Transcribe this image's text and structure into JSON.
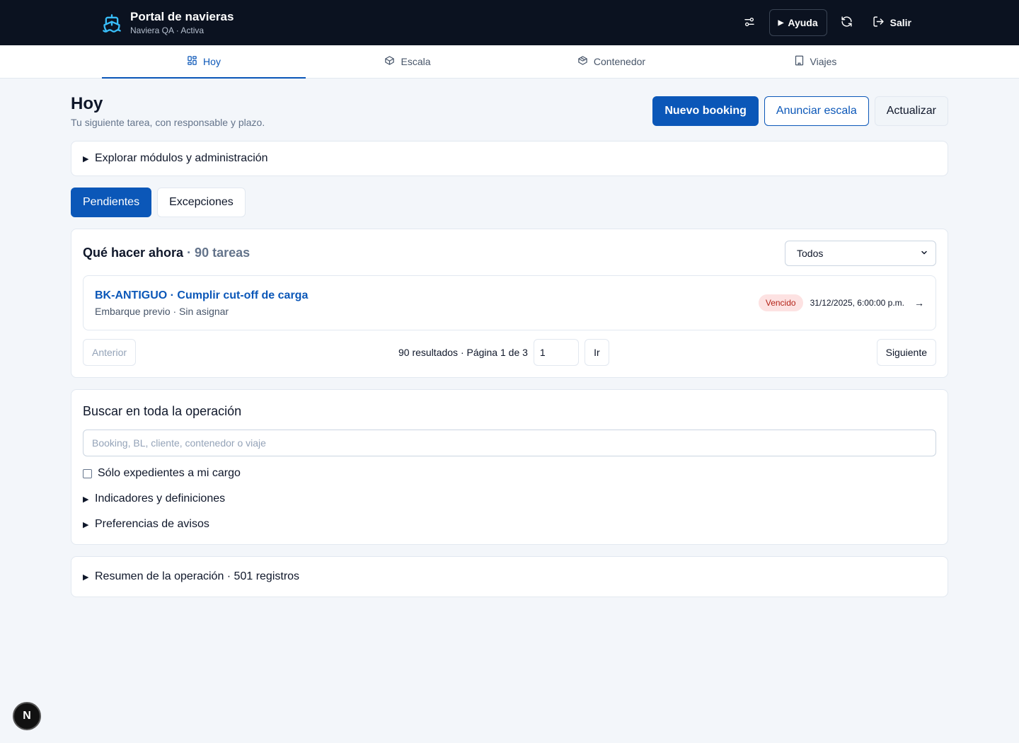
{
  "header": {
    "app_title": "Portal de navieras",
    "app_subtitle": "Naviera QA · Activa",
    "brand_icon": "ship-icon",
    "help_label": "Ayuda",
    "logout_label": "Salir",
    "icons": [
      "sliders-icon",
      "play-icon",
      "refresh-icon",
      "logout-icon"
    ]
  },
  "nav": {
    "tabs": [
      {
        "label": "Hoy",
        "icon": "grid-icon",
        "active": true
      },
      {
        "label": "Escala",
        "icon": "box-icon",
        "active": false
      },
      {
        "label": "Contenedor",
        "icon": "container-icon",
        "active": false
      },
      {
        "label": "Viajes",
        "icon": "building-icon",
        "active": false
      }
    ]
  },
  "page": {
    "title": "Hoy",
    "subtitle": "Tu siguiente tarea, con responsable y plazo.",
    "actions": {
      "new_booking": "Nuevo booking",
      "announce_call": "Anunciar escala",
      "refresh": "Actualizar"
    }
  },
  "explore": {
    "label": "Explorar módulos y administración"
  },
  "segments": {
    "pending": "Pendientes",
    "exceptions": "Excepciones"
  },
  "tasks": {
    "title": "Qué hacer ahora",
    "count": " · 90 tareas",
    "filter_value": "Todos",
    "items": [
      {
        "title": "BK-ANTIGUO · Cumplir cut-off de carga",
        "meta": "Embarque previo · Sin asignar",
        "status": "Vencido",
        "due": "31/12/2025, 6:00:00 p.m.",
        "arrow": "→"
      }
    ],
    "pager": {
      "prev": "Anterior",
      "summary": "90 resultados · Página 1 de 3",
      "page_value": "1",
      "go": "Ir",
      "next": "Siguiente"
    }
  },
  "search": {
    "title": "Buscar en toda la operación",
    "placeholder": "Booking, BL, cliente, contenedor o viaje",
    "only_mine": "Sólo expedientes a mi cargo",
    "indicators": "Indicadores y definiciones",
    "notifications": "Preferencias de avisos"
  },
  "summary": {
    "label": "Resumen de la operación · 501 registros"
  },
  "dev_badge": "N",
  "colors": {
    "accent": "#0b57b8",
    "topbar": "#0b1220",
    "danger_bg": "#fde2e2",
    "danger_text": "#b42318"
  }
}
